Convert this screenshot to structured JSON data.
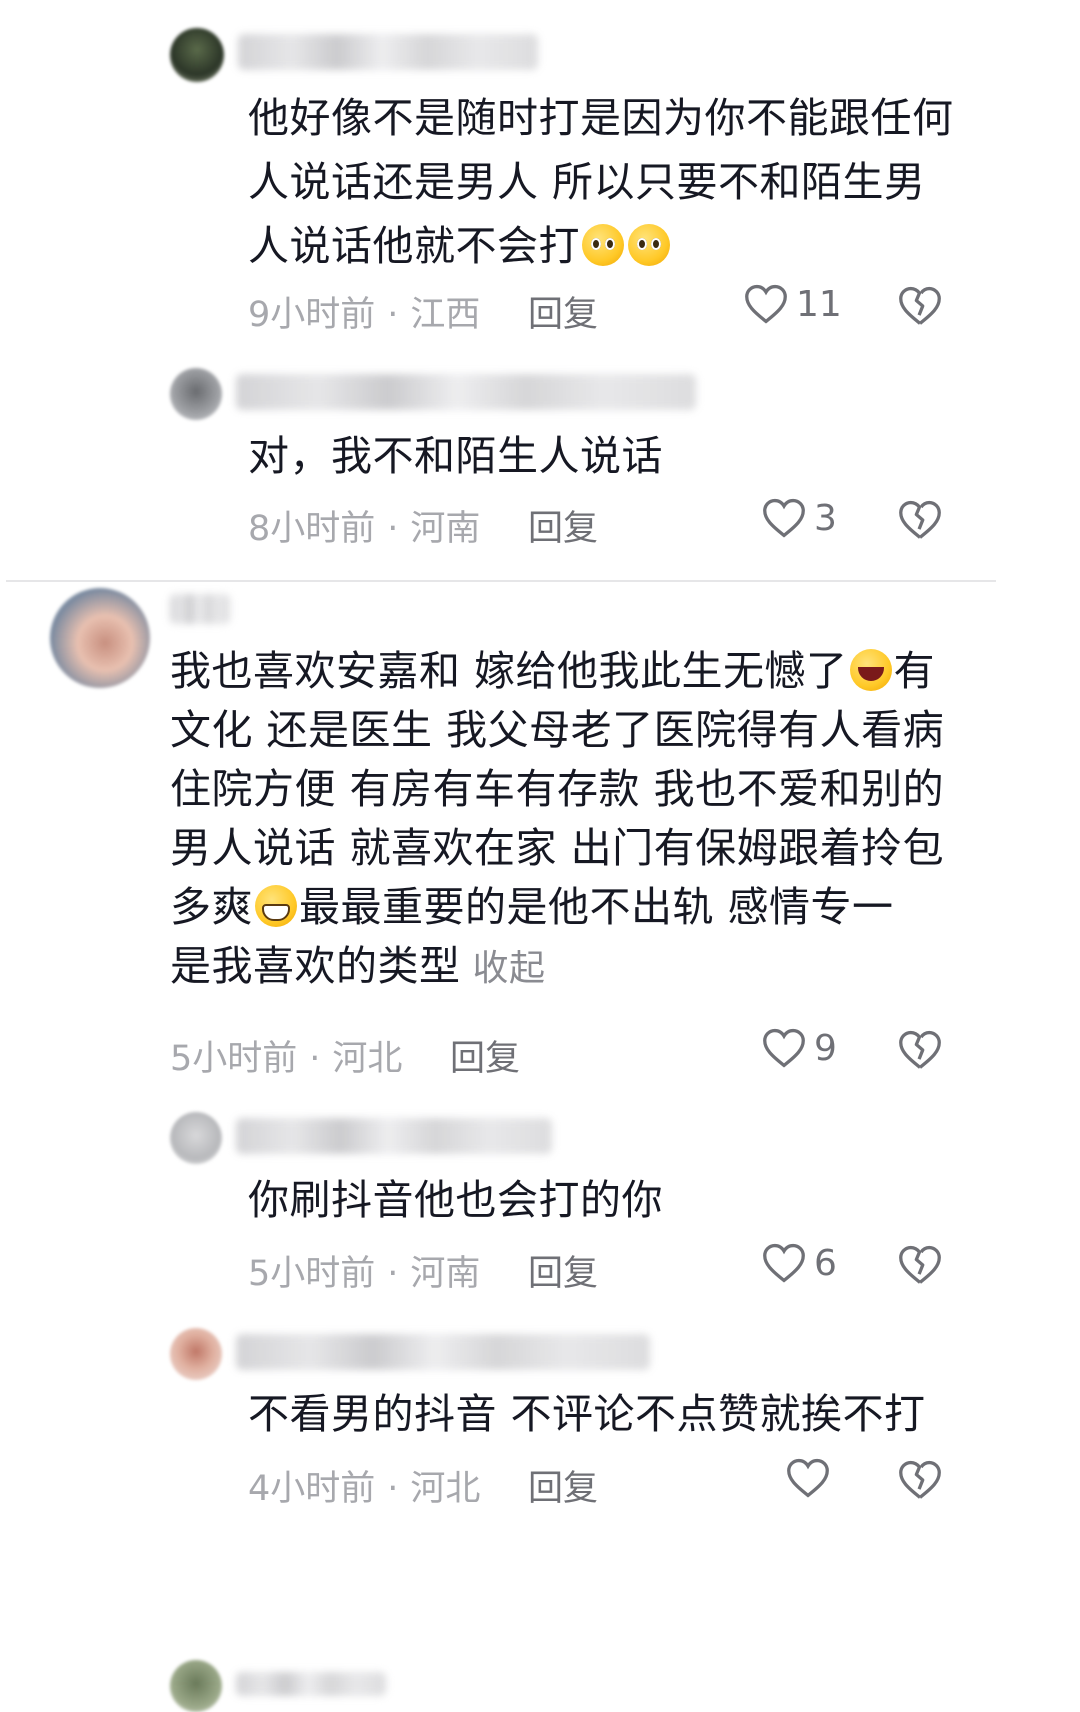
{
  "comments": [
    {
      "text_lines": [
        "他好像不是随时打是因为你不能跟任何",
        "人说话还是男人 所以只要不和陌生男",
        "人说话他就不会打"
      ],
      "emoji": [
        "plead",
        "plead"
      ],
      "time": "9小时前",
      "location": "江西",
      "reply_label": "回复",
      "likes": "11"
    },
    {
      "text_lines": [
        "对，我不和陌生人说话"
      ],
      "time": "8小时前",
      "location": "河南",
      "reply_label": "回复",
      "likes": "3"
    },
    {
      "text_lines": [
        "我也喜欢安嘉和 嫁给他我此生无憾了",
        "有",
        "文化 还是医生 我父母老了医院得有人看病",
        "住院方便  有房有车有存款 我也不爱和别的",
        "男人说话 就喜欢在家 出门有保姆跟着拎包",
        "多爽",
        "最最重要的是他不出轨 感情专一",
        "是我喜欢的类型"
      ],
      "collapse_label": "收起",
      "time": "5小时前",
      "location": "河北",
      "reply_label": "回复",
      "likes": "9"
    },
    {
      "text_lines": [
        "你刷抖音他也会打的你"
      ],
      "time": "5小时前",
      "location": "河南",
      "reply_label": "回复",
      "likes": "6"
    },
    {
      "text_lines": [
        "不看男的抖音 不评论不点赞就挨不打"
      ],
      "time": "4小时前",
      "location": "河北",
      "reply_label": "回复",
      "likes": ""
    }
  ],
  "meta_separator": "·",
  "icons": {
    "like": "heart-outline-icon",
    "dislike": "broken-heart-icon"
  },
  "colors": {
    "text": "#161823",
    "meta": "#a7a8ad",
    "action": "#6f7076",
    "divider": "#e6e6e8"
  }
}
